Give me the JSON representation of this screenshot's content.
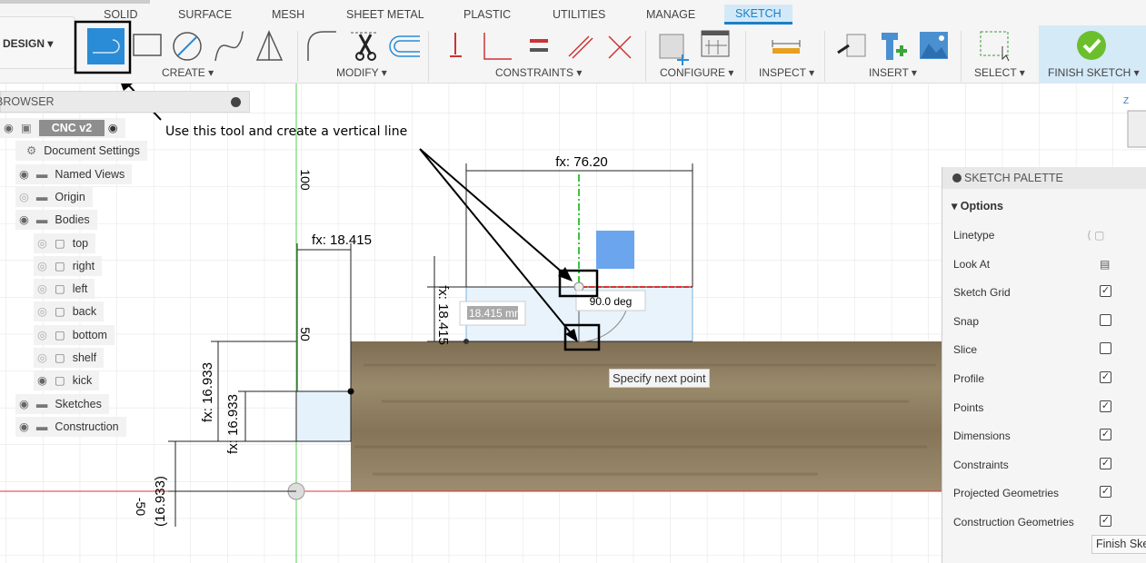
{
  "toolbar": {
    "tabs": [
      "SOLID",
      "SURFACE",
      "MESH",
      "SHEET METAL",
      "PLASTIC",
      "UTILITIES",
      "MANAGE",
      "SKETCH"
    ],
    "active_tab": "SKETCH",
    "workspace": "DESIGN",
    "groups": [
      "CREATE",
      "MODIFY",
      "CONSTRAINTS",
      "CONFIGURE",
      "INSPECT",
      "INSERT",
      "SELECT",
      "FINISH SKETCH"
    ]
  },
  "browser": {
    "title": "BROWSER",
    "items": [
      {
        "label": "CNC v2",
        "icon": "component-icon"
      },
      {
        "label": "Document Settings",
        "icon": "gear-icon"
      },
      {
        "label": "Named Views",
        "icon": "folder-icon"
      },
      {
        "label": "Origin",
        "icon": "folder-icon",
        "hidden": true
      },
      {
        "label": "Bodies",
        "icon": "folder-icon"
      },
      {
        "label": "top",
        "icon": "body-icon",
        "hidden": true
      },
      {
        "label": "right",
        "icon": "body-icon",
        "hidden": true
      },
      {
        "label": "left",
        "icon": "body-icon",
        "hidden": true
      },
      {
        "label": "back",
        "icon": "body-icon",
        "hidden": true
      },
      {
        "label": "bottom",
        "icon": "body-icon",
        "hidden": true
      },
      {
        "label": "shelf",
        "icon": "body-icon",
        "hidden": true
      },
      {
        "label": "kick",
        "icon": "body-icon"
      },
      {
        "label": "Sketches",
        "icon": "folder-icon"
      },
      {
        "label": "Construction",
        "icon": "folder-icon"
      }
    ]
  },
  "annotation": {
    "text": "Use this tool and create a vertical line"
  },
  "sketch": {
    "dims": {
      "top_width": "fx: 76.20",
      "left_width": "fx: 18.415",
      "height_right": "fx: 18.415",
      "height_left1": "fx: 16.933",
      "height_left2": "fx: 16.933",
      "ref": "(16.933)",
      "ruler_100": "100",
      "ruler_50": "50",
      "ruler_neg50": "-50"
    },
    "length_input": "18.415 mm",
    "angle_input": "90.0 deg",
    "tooltip": "Specify next point"
  },
  "palette": {
    "title": "SKETCH PALETTE",
    "section": "Options",
    "rows": [
      {
        "label": "Linetype",
        "type": "icons"
      },
      {
        "label": "Look At",
        "type": "icon"
      },
      {
        "label": "Sketch Grid",
        "checked": true
      },
      {
        "label": "Snap",
        "checked": false
      },
      {
        "label": "Slice",
        "checked": false
      },
      {
        "label": "Profile",
        "checked": true
      },
      {
        "label": "Points",
        "checked": true
      },
      {
        "label": "Dimensions",
        "checked": true
      },
      {
        "label": "Constraints",
        "checked": true
      },
      {
        "label": "Projected Geometries",
        "checked": true
      },
      {
        "label": "Construction Geometries",
        "checked": true
      }
    ],
    "finish_button": "Finish Sketch"
  },
  "colors": {
    "accent": "#1a7fc7",
    "finish": "#6cbf2c",
    "wood": "#8b7a5c",
    "axis_red": "#e03030",
    "axis_green": "#3cc43c"
  }
}
